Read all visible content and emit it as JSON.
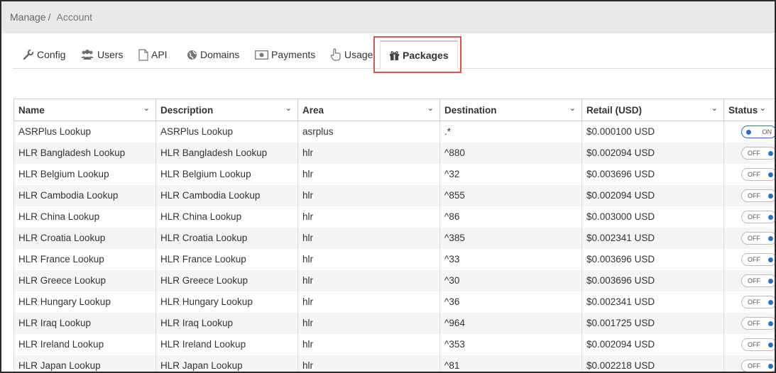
{
  "breadcrumb": {
    "root": "Manage",
    "separator": "/",
    "current": "Account"
  },
  "tabs": [
    {
      "label": "Config",
      "icon": "wrench-icon"
    },
    {
      "label": "Users",
      "icon": "users-icon"
    },
    {
      "label": "API",
      "icon": "document-icon"
    },
    {
      "label": "Domains",
      "icon": "globe-icon"
    },
    {
      "label": "Payments",
      "icon": "money-icon"
    },
    {
      "label": "Usage",
      "icon": "hand-pointer-icon"
    },
    {
      "label": "Packages",
      "icon": "gift-icon",
      "active": true
    }
  ],
  "table": {
    "columns": [
      "Name",
      "Description",
      "Area",
      "Destination",
      "Retail (USD)",
      "Status"
    ],
    "rows": [
      {
        "name": "ASRPlus Lookup",
        "description": "ASRPlus Lookup",
        "area": "asrplus",
        "destination": ".*",
        "retail": "$0.000100 USD",
        "status": "ON"
      },
      {
        "name": "HLR Bangladesh Lookup",
        "description": "HLR Bangladesh Lookup",
        "area": "hlr",
        "destination": "^880",
        "retail": "$0.002094 USD",
        "status": "OFF"
      },
      {
        "name": "HLR Belgium Lookup",
        "description": "HLR Belgium Lookup",
        "area": "hlr",
        "destination": "^32",
        "retail": "$0.003696 USD",
        "status": "OFF"
      },
      {
        "name": "HLR Cambodia Lookup",
        "description": "HLR Cambodia Lookup",
        "area": "hlr",
        "destination": "^855",
        "retail": "$0.002094 USD",
        "status": "OFF"
      },
      {
        "name": "HLR China Lookup",
        "description": "HLR China Lookup",
        "area": "hlr",
        "destination": "^86",
        "retail": "$0.003000 USD",
        "status": "OFF"
      },
      {
        "name": "HLR Croatia Lookup",
        "description": "HLR Croatia Lookup",
        "area": "hlr",
        "destination": "^385",
        "retail": "$0.002341 USD",
        "status": "OFF"
      },
      {
        "name": "HLR France Lookup",
        "description": "HLR France Lookup",
        "area": "hlr",
        "destination": "^33",
        "retail": "$0.003696 USD",
        "status": "OFF"
      },
      {
        "name": "HLR Greece Lookup",
        "description": "HLR Greece Lookup",
        "area": "hlr",
        "destination": "^30",
        "retail": "$0.003696 USD",
        "status": "OFF"
      },
      {
        "name": "HLR Hungary Lookup",
        "description": "HLR Hungary Lookup",
        "area": "hlr",
        "destination": "^36",
        "retail": "$0.002341 USD",
        "status": "OFF"
      },
      {
        "name": "HLR Iraq Lookup",
        "description": "HLR Iraq Lookup",
        "area": "hlr",
        "destination": "^964",
        "retail": "$0.001725 USD",
        "status": "OFF"
      },
      {
        "name": "HLR Ireland Lookup",
        "description": "HLR Ireland Lookup",
        "area": "hlr",
        "destination": "^353",
        "retail": "$0.002094 USD",
        "status": "OFF"
      },
      {
        "name": "HLR Japan Lookup",
        "description": "HLR Japan Lookup",
        "area": "hlr",
        "destination": "^81",
        "retail": "$0.002218 USD",
        "status": "OFF"
      }
    ]
  },
  "colors": {
    "highlight": "#d9534f",
    "toggle_knob": "#2d6fc4",
    "breadcrumb_bg": "#e9e9e9"
  }
}
